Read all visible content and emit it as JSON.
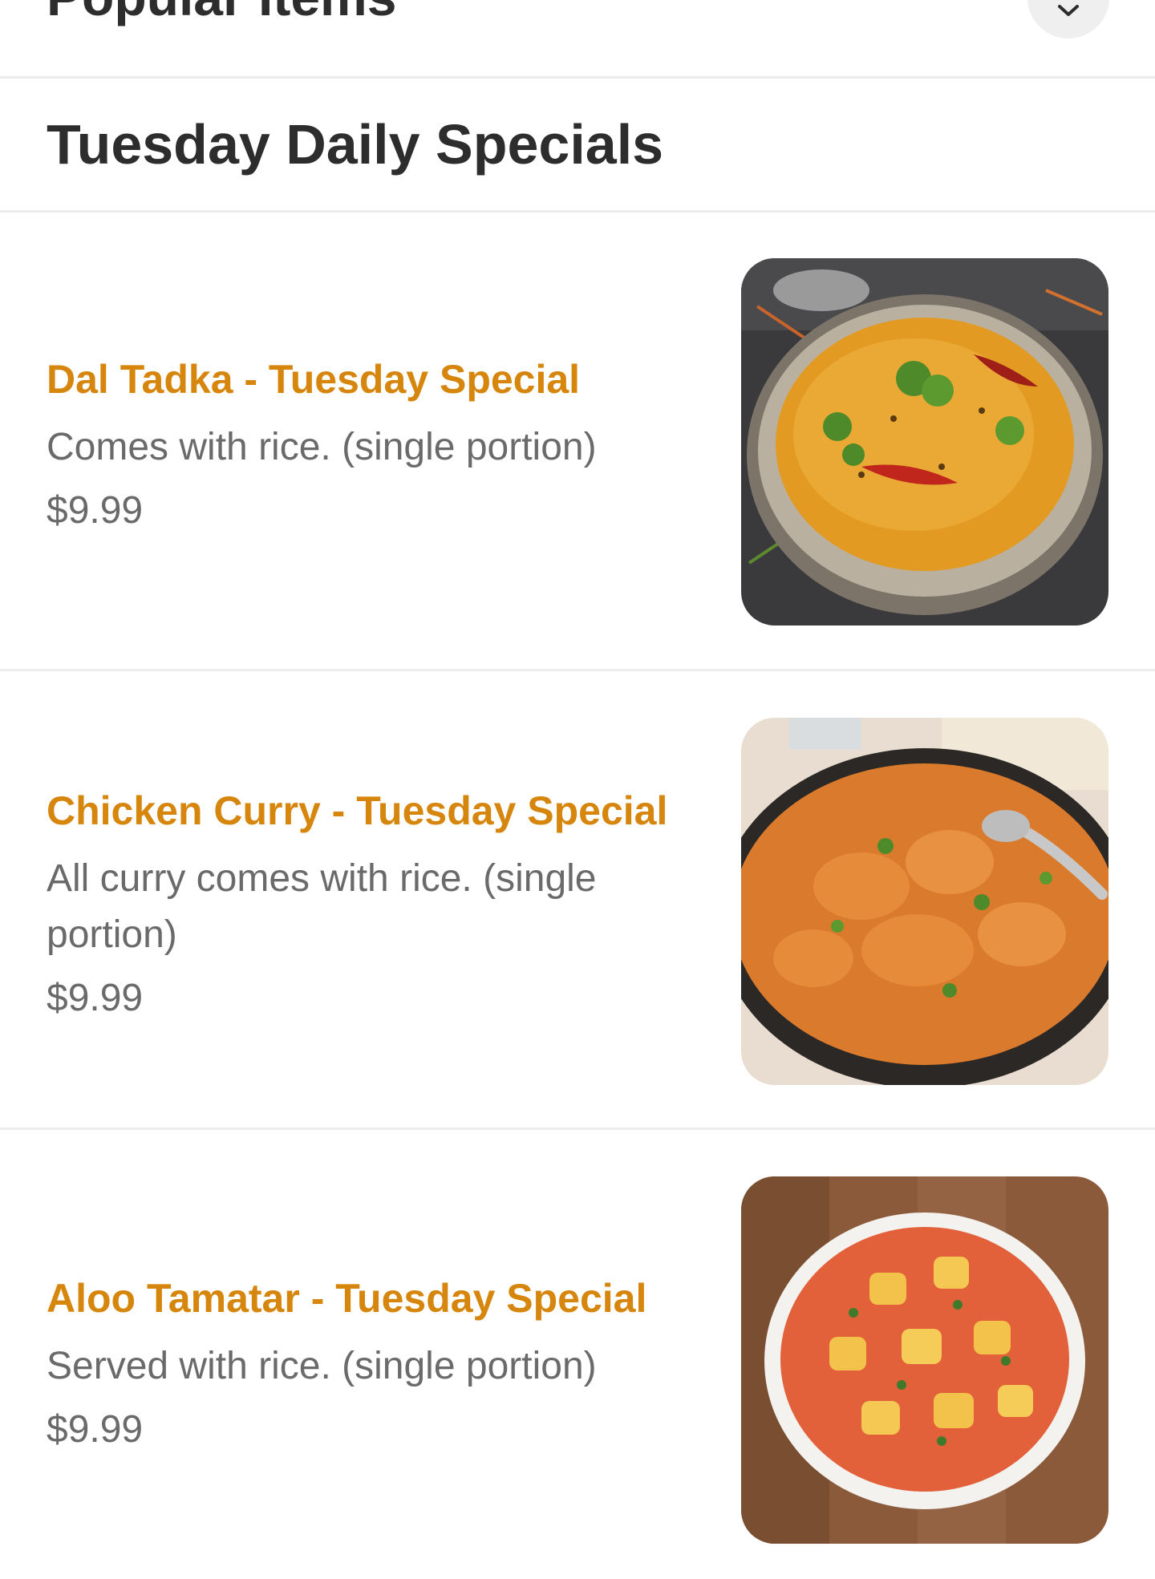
{
  "popular": {
    "title": "Popular Items"
  },
  "section": {
    "title": "Tuesday Daily Specials"
  },
  "items": [
    {
      "name": "Dal Tadka - Tuesday Special",
      "description": "Comes with rice. (single portion)",
      "price": "$9.99"
    },
    {
      "name": "Chicken Curry - Tuesday Special",
      "description": "All curry comes with rice. (single portion)",
      "price": "$9.99"
    },
    {
      "name": "Aloo Tamatar - Tuesday Special",
      "description": "Served with rice. (single portion)",
      "price": "$9.99"
    }
  ],
  "colors": {
    "item_name": "#d6860c",
    "secondary_text": "#6a6a6a",
    "divider": "#ececec"
  }
}
